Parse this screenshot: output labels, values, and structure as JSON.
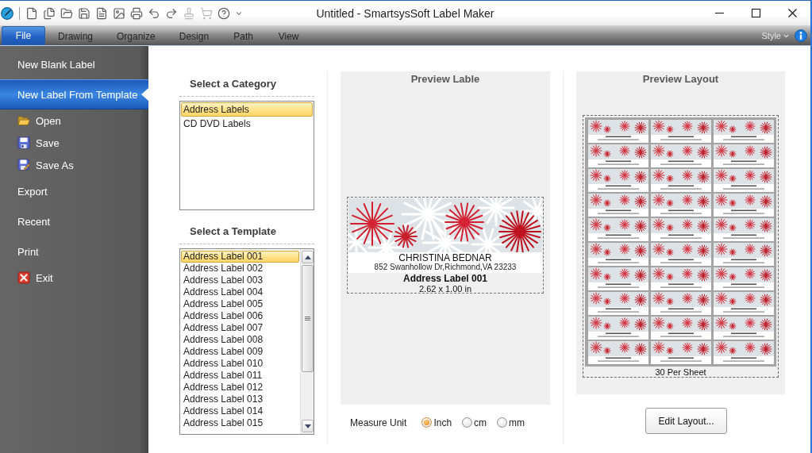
{
  "window": {
    "title": "Untitled - SmartsysSoft Label Maker"
  },
  "quick_access_toolbar": [
    {
      "kind": "new",
      "disabled": false
    },
    {
      "kind": "templates",
      "disabled": false
    },
    {
      "kind": "open",
      "disabled": false
    },
    {
      "kind": "save",
      "disabled": false
    },
    {
      "kind": "pdf",
      "disabled": false
    },
    {
      "kind": "image",
      "disabled": false
    },
    {
      "kind": "print",
      "disabled": false
    },
    {
      "kind": "undo",
      "disabled": false
    },
    {
      "kind": "redo",
      "disabled": false
    },
    {
      "kind": "stamp",
      "disabled": true
    },
    {
      "kind": "cart",
      "disabled": true
    },
    {
      "kind": "help",
      "disabled": false
    },
    {
      "kind": "customize",
      "disabled": false
    }
  ],
  "ribbon_tabs": [
    {
      "label": "File",
      "selected": true
    },
    {
      "label": "Drawing",
      "selected": false
    },
    {
      "label": "Organize",
      "selected": false
    },
    {
      "label": "Design",
      "selected": false
    },
    {
      "label": "Path",
      "selected": false
    },
    {
      "label": "View",
      "selected": false
    }
  ],
  "style_menu": {
    "label": "Style"
  },
  "sidebar": {
    "items": [
      {
        "label": "New Blank Label",
        "kind": "plain",
        "selected": false
      },
      {
        "label": "New Label From Template",
        "kind": "plain",
        "selected": true
      },
      {
        "label": "Open",
        "kind": "open",
        "selected": false
      },
      {
        "label": "Save",
        "kind": "save",
        "selected": false
      },
      {
        "label": "Save As",
        "kind": "save_as",
        "selected": false
      },
      {
        "label": "Export",
        "kind": "plain",
        "selected": false
      },
      {
        "label": "Recent",
        "kind": "plain",
        "selected": false
      },
      {
        "label": "Print",
        "kind": "plain",
        "selected": false
      },
      {
        "label": "Exit",
        "kind": "exit",
        "selected": false
      }
    ]
  },
  "category_panel": {
    "title": "Select a Category",
    "items": [
      {
        "label": "Address Labels",
        "selected": true
      },
      {
        "label": "CD DVD Labels",
        "selected": false
      }
    ]
  },
  "template_panel": {
    "title": "Select a Template",
    "items": [
      {
        "label": "Address Label 001",
        "selected": true
      },
      {
        "label": "Address Label 002",
        "selected": false
      },
      {
        "label": "Address Label 003",
        "selected": false
      },
      {
        "label": "Address Label 004",
        "selected": false
      },
      {
        "label": "Address Label 005",
        "selected": false
      },
      {
        "label": "Address Label 006",
        "selected": false
      },
      {
        "label": "Address Label 007",
        "selected": false
      },
      {
        "label": "Address Label 008",
        "selected": false
      },
      {
        "label": "Address Label 009",
        "selected": false
      },
      {
        "label": "Address Label 010",
        "selected": false
      },
      {
        "label": "Address Label 011",
        "selected": false
      },
      {
        "label": "Address Label 012",
        "selected": false
      },
      {
        "label": "Address Label 013",
        "selected": false
      },
      {
        "label": "Address Label 014",
        "selected": false
      },
      {
        "label": "Address Label 015",
        "selected": false
      }
    ]
  },
  "preview_label": {
    "title": "Preview Lable",
    "recipient_name": "CHRISTINA BEDNAR",
    "address": "852 Swanhollow Dr,Richmond,VA 23233",
    "template_name": "Address Label 001",
    "size": "2.62 x 1.00 in"
  },
  "measure_unit": {
    "label": "Measure Unit",
    "options": [
      {
        "label": "Inch",
        "selected": true
      },
      {
        "label": "cm",
        "selected": false
      },
      {
        "label": "mm",
        "selected": false
      }
    ]
  },
  "preview_layout": {
    "title": "Preview Layout",
    "caption": "30 Per Sheet",
    "button": "Edit Layout..."
  }
}
